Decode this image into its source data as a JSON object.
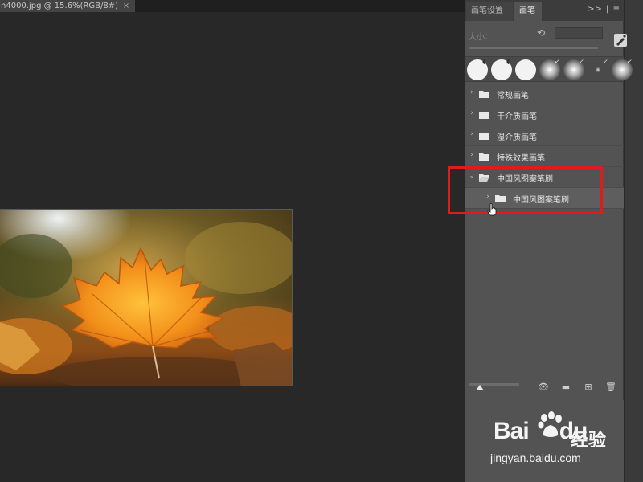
{
  "document": {
    "tab_title": "n4000.jpg @ 15.6%(RGB/8#)",
    "close_glyph": "×"
  },
  "panel": {
    "tabs": [
      {
        "label": "画笔设置",
        "active": false
      },
      {
        "label": "画笔",
        "active": true
      }
    ],
    "menu_glyphs": ">> | ≡",
    "size_label": "大小：",
    "size_value": "",
    "reset_icon": "reset-icon",
    "new_brush_icon": "brush-new-icon"
  },
  "tree": {
    "items": [
      {
        "label": "常规画笔",
        "expanded": false
      },
      {
        "label": "干介质画笔",
        "expanded": false
      },
      {
        "label": "湿介质画笔",
        "expanded": false
      },
      {
        "label": "特殊效果画笔",
        "expanded": false
      },
      {
        "label": "中国风图案笔刷",
        "expanded": true
      },
      {
        "label": "中国风图案笔刷",
        "expanded": false,
        "child": true
      }
    ]
  },
  "bottom_toolbar": {
    "icons": [
      "size-slider",
      "eye-brush-icon",
      "folder-icon",
      "new-icon",
      "trash-icon"
    ]
  },
  "watermark": {
    "logo_left": "Bai",
    "logo_right": "du",
    "logo_cn": "经验",
    "url": "jingyan.baidu.com"
  },
  "colors": {
    "highlight": "#e01b1b",
    "panel_bg": "#535353",
    "canvas_bg": "#282828"
  }
}
